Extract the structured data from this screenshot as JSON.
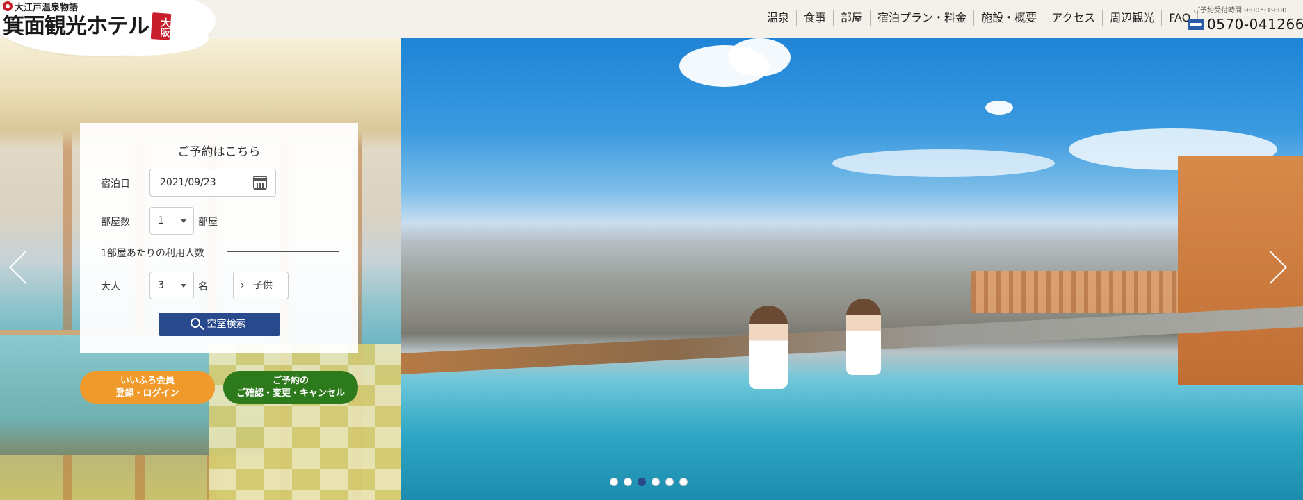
{
  "header": {
    "logo_subtitle": "大江戸温泉物語",
    "logo_title": "箕面観光ホテル",
    "logo_badge": "大阪",
    "nav": [
      "温泉",
      "食事",
      "部屋",
      "宿泊プラン・料金",
      "施設・概要",
      "アクセス",
      "周辺観光",
      "FAQ"
    ],
    "contact_hours": "ご予約受付時間 9:00〜19:00",
    "phone": "0570-041266",
    "phone_icon": "freedial-icon"
  },
  "booking": {
    "title": "ご予約はこちら",
    "date_label": "宿泊日",
    "date_value": "2021/09/23",
    "rooms_label": "部屋数",
    "rooms_value": "1",
    "rooms_unit": "部屋",
    "guests_heading": "1部屋あたりの利用人数",
    "adults_label": "大人",
    "adults_value": "3",
    "adults_unit": "名",
    "children_label": "子供",
    "search_label": "空室検索"
  },
  "actions": {
    "member_line1": "いいふろ会員",
    "member_line2": "登録・ログイン",
    "reservation_line1": "ご予約の",
    "reservation_line2": "ご確認・変更・キャンセル"
  },
  "carousel": {
    "slides": 6,
    "active_slide": 3
  },
  "colors": {
    "accent_blue": "#284a8c",
    "orange": "#ef9a2a",
    "green": "#2d7a1d",
    "brand_red": "#c81e2b"
  }
}
